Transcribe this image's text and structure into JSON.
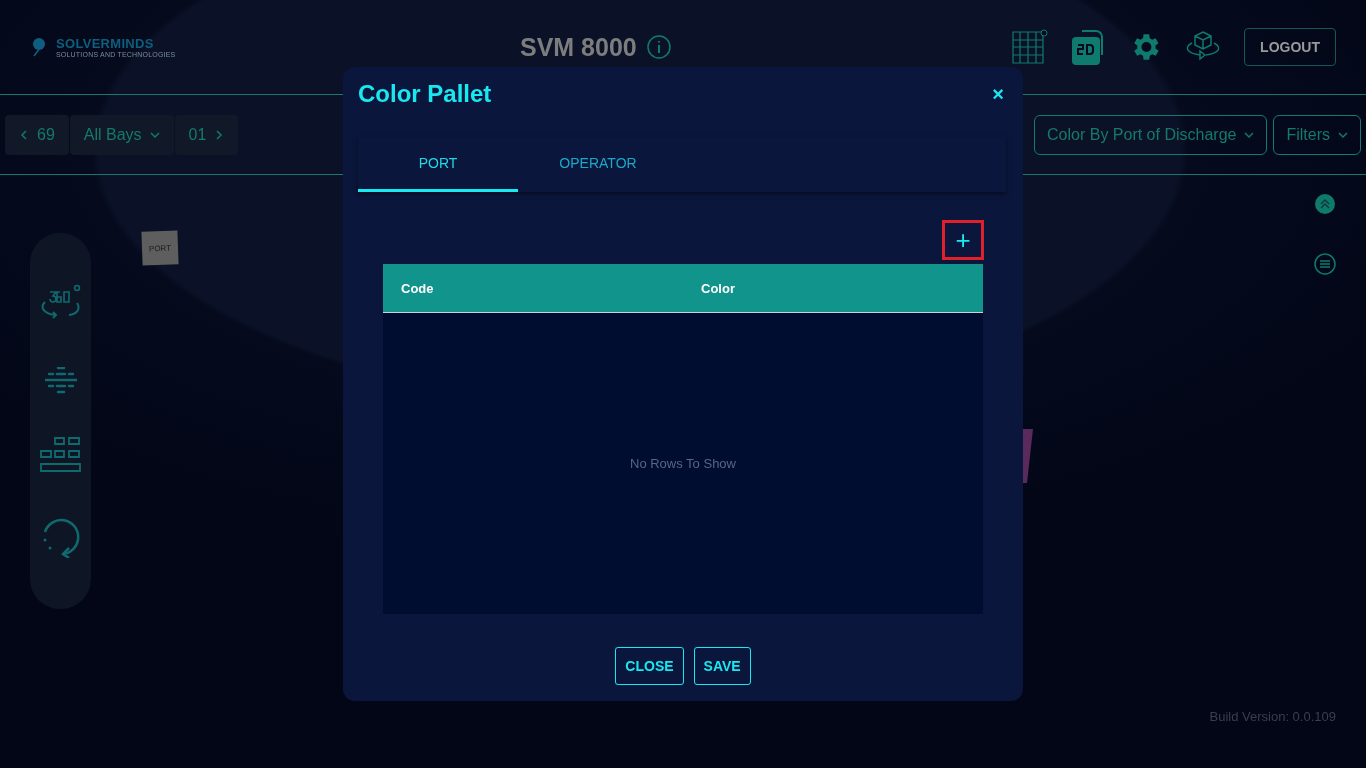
{
  "header": {
    "logo": {
      "name": "SOLVERMINDS",
      "tagline": "SOLUTIONS AND TECHNOLOGIES"
    },
    "title": "SVM 8000",
    "logout": "LOGOUT"
  },
  "toolbar": {
    "prev_bay": "69",
    "bays": "All Bays",
    "next_bay": "01",
    "color_by": "Color By Port of Discharge",
    "filters": "Filters"
  },
  "scene": {
    "sign": "PORT"
  },
  "build_version": "Build Version: 0.0.109",
  "dialog": {
    "title": "Color Pallet",
    "close_icon": "×",
    "tabs": [
      {
        "label": "PORT",
        "selected": true
      },
      {
        "label": "OPERATOR",
        "selected": false
      }
    ],
    "add_button": "+",
    "table": {
      "columns": [
        "Code",
        "Color"
      ],
      "empty_text": "No Rows To Show"
    },
    "buttons": [
      "CLOSE",
      "SAVE"
    ]
  }
}
